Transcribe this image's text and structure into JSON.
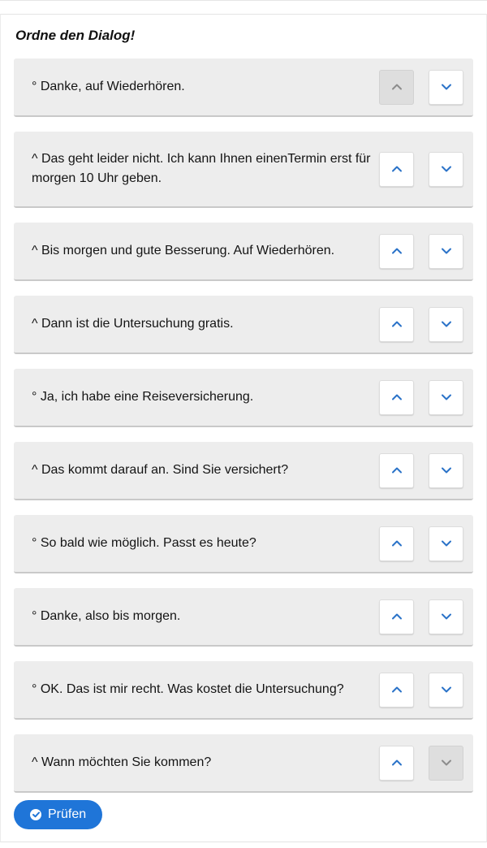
{
  "exercise": {
    "title": "Ordne den Dialog!",
    "check_label": "Prüfen",
    "items": [
      {
        "text": "° Danke, auf Wiederhören.",
        "up_disabled": true,
        "down_disabled": false
      },
      {
        "text": "^ Das geht leider nicht. Ich kann Ihnen einenTermin erst für morgen 10 Uhr geben.",
        "up_disabled": false,
        "down_disabled": false
      },
      {
        "text": "^ Bis morgen und gute Besserung. Auf Wiederhören.",
        "up_disabled": false,
        "down_disabled": false
      },
      {
        "text": "^ Dann ist die Untersuchung gratis.",
        "up_disabled": false,
        "down_disabled": false
      },
      {
        "text": "° Ja, ich habe eine Reiseversicherung.",
        "up_disabled": false,
        "down_disabled": false
      },
      {
        "text": "^ Das kommt darauf an. Sind Sie versichert?",
        "up_disabled": false,
        "down_disabled": false
      },
      {
        "text": "° So bald wie möglich. Passt es heute?",
        "up_disabled": false,
        "down_disabled": false
      },
      {
        "text": "° Danke, also bis morgen.",
        "up_disabled": false,
        "down_disabled": false
      },
      {
        "text": "° OK. Das ist mir recht. Was kostet die Untersuchung?",
        "up_disabled": false,
        "down_disabled": false
      },
      {
        "text": "^ Wann möchten Sie kommen?",
        "up_disabled": false,
        "down_disabled": true
      }
    ],
    "icons": {
      "up": "chevron-up-icon",
      "down": "chevron-down-icon",
      "check": "check-circle-icon"
    },
    "colors": {
      "accent": "#1f75d8",
      "item_bg": "#ededed",
      "disabled_bg": "#dedede"
    }
  }
}
